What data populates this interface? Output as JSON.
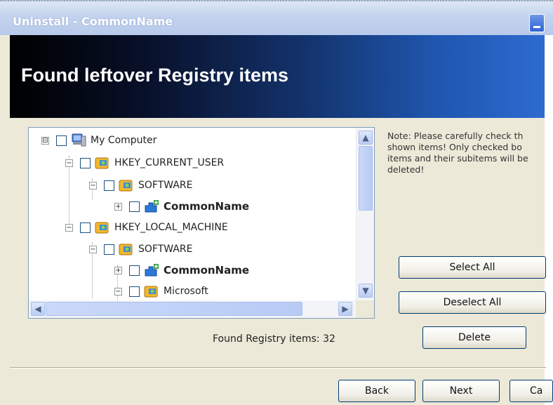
{
  "window": {
    "title": "Uninstall - CommonName"
  },
  "banner": {
    "heading": "Found leftover Registry items"
  },
  "tree": {
    "items": [
      {
        "label": "My Computer",
        "bold": false,
        "icon": "computer-icon",
        "expander": "⊟"
      },
      {
        "label": "HKEY_CURRENT_USER",
        "bold": false,
        "icon": "registry-hive-icon",
        "expander": "−"
      },
      {
        "label": "SOFTWARE",
        "bold": false,
        "icon": "registry-key-icon",
        "expander": "−"
      },
      {
        "label": "CommonName",
        "bold": true,
        "icon": "app-puzzle-icon",
        "expander": "+"
      },
      {
        "label": "HKEY_LOCAL_MACHINE",
        "bold": false,
        "icon": "registry-hive-icon",
        "expander": "−"
      },
      {
        "label": "SOFTWARE",
        "bold": false,
        "icon": "registry-key-icon",
        "expander": "−"
      },
      {
        "label": "CommonName",
        "bold": true,
        "icon": "app-puzzle-icon",
        "expander": "+"
      },
      {
        "label": "Microsoft",
        "bold": false,
        "icon": "registry-key-icon",
        "expander": "−"
      }
    ]
  },
  "note": {
    "text": "Note: Please carefully check th\nshown items! Only checked bo\nitems and their subitems will be\ndeleted!"
  },
  "actions": {
    "select_all": "Select All",
    "deselect_all": "Deselect All",
    "delete": "Delete"
  },
  "status": {
    "found_label": "Found Registry items:",
    "found_count": "32"
  },
  "footer": {
    "back": "Back",
    "next": "Next",
    "cancel": "Ca"
  }
}
